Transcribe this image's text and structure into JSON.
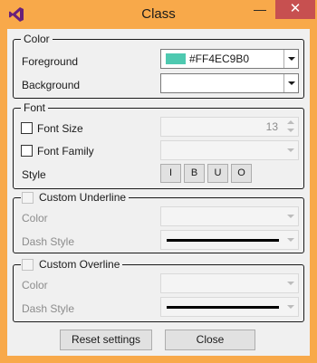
{
  "window": {
    "title": "Class"
  },
  "color_group": {
    "legend": "Color",
    "foreground_label": "Foreground",
    "foreground_value": "#FF4EC9B0",
    "foreground_swatch": "#4ec9b0",
    "background_label": "Background",
    "background_value": ""
  },
  "font_group": {
    "legend": "Font",
    "font_size_label": "Font Size",
    "font_size_value": "13",
    "font_family_label": "Font Family",
    "style_label": "Style",
    "style_buttons": [
      "I",
      "B",
      "U",
      "O"
    ]
  },
  "underline_group": {
    "legend": "Custom Underline",
    "color_label": "Color",
    "dash_label": "Dash Style"
  },
  "overline_group": {
    "legend": "Custom Overline",
    "color_label": "Color",
    "dash_label": "Dash Style"
  },
  "buttons": {
    "reset": "Reset settings",
    "close": "Close"
  }
}
